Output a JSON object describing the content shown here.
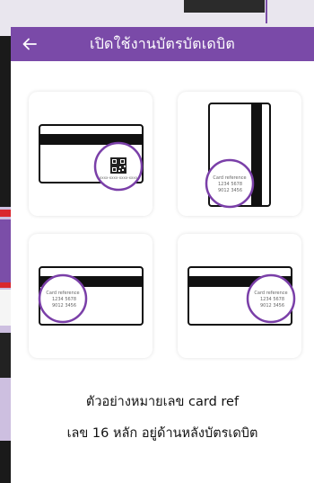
{
  "header": {
    "title": "เปิดใช้งานบัตรบัตเดบิต",
    "back_icon": "back-arrow-icon",
    "background_color": "#7a4aa8"
  },
  "cards": [
    {
      "orientation": "horizontal",
      "reference_type": "qr-code",
      "reference_text": "xxxx-xxxx-xxxx-xxxx"
    },
    {
      "orientation": "vertical",
      "reference_type": "card-reference",
      "reference_title": "Card reference",
      "reference_line1": "1234 5678",
      "reference_line2": "9012 3456"
    },
    {
      "orientation": "horizontal",
      "reference_type": "card-reference",
      "reference_title": "Card reference",
      "reference_line1": "1234 5678",
      "reference_line2": "9012 3456"
    },
    {
      "orientation": "horizontal",
      "reference_type": "card-reference",
      "reference_title": "Card reference",
      "reference_line1": "1234 5678",
      "reference_line2": "9012 3456"
    }
  ],
  "caption": {
    "line1": "ตัวอย่างหมายเลข card ref",
    "line2": "เลข 16  หลัก อยู่ด้านหลังบัตรเดบิต"
  },
  "colors": {
    "accent": "#7a4aa8",
    "highlight_circle": "#7a3fa8"
  }
}
